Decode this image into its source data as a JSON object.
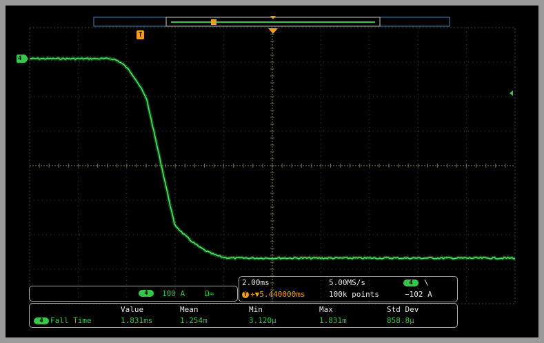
{
  "colors": {
    "trace": "#36c74a",
    "grid": "#3a4a52",
    "trigger": "#f0a020",
    "text": "#e6e6e6",
    "record_bar": "#4a88b8"
  },
  "icons": {
    "channel_marker": "channel-4-marker-icon",
    "trigger_marker": "trigger-marker-icon",
    "falling_edge": "falling-edge-icon"
  },
  "trigger_label": "T",
  "channel_marker_label": "4",
  "channel_status": {
    "badge": "4",
    "scale": "100 A",
    "coupling": "Ω≈"
  },
  "horizontal": {
    "time_per_div": "2.00ms",
    "sample_rate": "5.00MS/s",
    "trigger_badge": "T",
    "position": "+▼5.440000ms",
    "record_length": "100k points"
  },
  "trigger": {
    "source_badge": "4",
    "slope": "\\",
    "level": "−102 A"
  },
  "measurements": {
    "headers": [
      "Value",
      "Mean",
      "Min",
      "Max",
      "Std Dev"
    ],
    "rows": [
      {
        "badge": "4",
        "name": "Fall Time",
        "values": [
          "1.831ms",
          "1.254m",
          "3.120μ",
          "1.831m",
          "858.8μ"
        ]
      }
    ]
  }
}
